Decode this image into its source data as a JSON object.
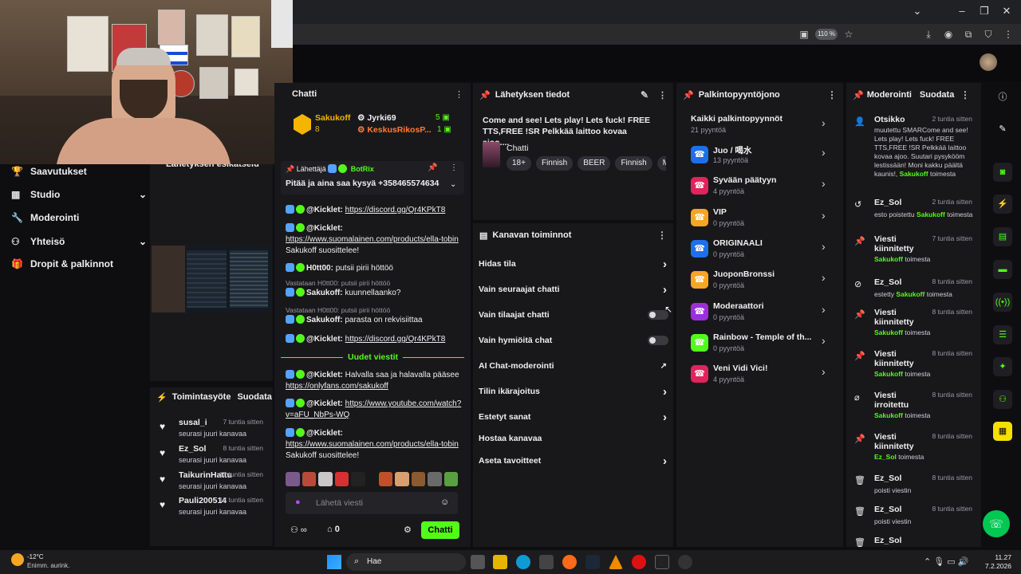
{
  "browser": {
    "zoom": "110 %"
  },
  "sidebar": {
    "items": [
      {
        "label": "Saavutukset",
        "icon": "trophy-icon",
        "chevron": false
      },
      {
        "label": "Studio",
        "icon": "studio-icon",
        "chevron": true
      },
      {
        "label": "Moderointi",
        "icon": "wrench-icon",
        "chevron": false
      },
      {
        "label": "Yhteisö",
        "icon": "community-icon",
        "chevron": true
      },
      {
        "label": "Dropit & palkinnot",
        "icon": "gift-icon",
        "chevron": false
      }
    ],
    "preview_title": "Lähetyksen esikatselu"
  },
  "activity": {
    "title": "Toimintasyöte",
    "subscribe": "Suodata",
    "items": [
      {
        "user": "susal_i",
        "time": "7 tuntia sitten",
        "text": "seurasi juuri kanavaa"
      },
      {
        "user": "Ez_Sol",
        "time": "8 tuntia sitten",
        "text": "seurasi juuri kanavaa"
      },
      {
        "user": "TaikurinHattu",
        "time": "12 tuntia sitten",
        "text": "seurasi juuri kanavaa"
      },
      {
        "user": "Pauli200514",
        "time": "12 tuntia sitten",
        "text": "seurasi juuri kanavaa"
      }
    ]
  },
  "chat": {
    "title": "Chatti",
    "leaderboard": [
      {
        "name": "Sakukoff",
        "count": "5",
        "sub": "8"
      },
      {
        "name": "Jyrki69",
        "count": "1",
        "sub": ""
      },
      {
        "name": "KeskusRikosP...",
        "count": "",
        "sub": ""
      }
    ],
    "pinned_sender_label": "Lähettäjä",
    "pinned_sender": "BotRix",
    "pinned_text": "Pitää ja aina saa kysyä +358465574634",
    "messages": [
      {
        "user": "@Kicklet:",
        "text": "https://discord.gg/Qr4KPkT8",
        "link": true
      },
      {
        "user": "@Kicklet:",
        "text": "https://www.suomalainen.com/products/ella-tobin",
        "link": true,
        "extra": "Sakukoff suosittelee!"
      },
      {
        "user": "H0tt00:",
        "text": "putsii pirii höttöö",
        "link": false
      },
      {
        "reply": "Vastataan H0tt00: putsii pirii höttöö",
        "user": "Sakukoff:",
        "text": "kuunnellaanko?"
      },
      {
        "reply": "Vastataan H0tt00: putsii pirii höttöö",
        "user": "Sakukoff:",
        "text": "parasta on rekvisiittaa"
      },
      {
        "user": "@Kicklet:",
        "text": "https://discord.gg/Qr4KPkT8",
        "link": true
      }
    ],
    "new_messages": "Uudet viestit",
    "messages2": [
      {
        "user": "@Kicklet:",
        "text": "Halvalla saa ja halavalla pääsee",
        "link2": "https://onlyfans.com/sakukoff"
      },
      {
        "user": "@Kicklet:",
        "text": "https://www.youtube.com/watch?v=aFU_NbPs-WQ"
      },
      {
        "user": "@Kicklet:",
        "text": "https://www.suomalainen.com/products/ella-tobin",
        "extra": "Sakukoff suosittelee!"
      }
    ],
    "input_placeholder": "Lähetä viesti",
    "points": "0",
    "send": "Chatti"
  },
  "stream_info": {
    "title": "Lähetyksen tiedot",
    "text": "Come and see! Lets play! Lets fuck! FREE TTS,FREE !SR Pelkkää laittoo kovaa ajoo....",
    "category": "Chatti",
    "tags": [
      "18+",
      "Finnish",
      "BEER",
      "Finnish",
      "M"
    ]
  },
  "channel_actions": {
    "title": "Kanavan toiminnot",
    "items": [
      {
        "label": "Hidas tila",
        "control": "chevron"
      },
      {
        "label": "Vain seuraajat chatti",
        "control": "chevron"
      },
      {
        "label": "Vain tilaajat chatti",
        "control": "toggle"
      },
      {
        "label": "Vain hymiöitä chat",
        "control": "toggle"
      },
      {
        "label": "AI Chat-moderointi",
        "control": "external"
      },
      {
        "label": "Tilin ikärajoitus",
        "control": "chevron"
      },
      {
        "label": "Estetyt sanat",
        "control": "chevron"
      },
      {
        "label": "Hostaa kanavaa",
        "control": "none"
      },
      {
        "label": "Aseta tavoitteet",
        "control": "chevron"
      }
    ]
  },
  "rewards": {
    "title": "Palkintopyyntöjono",
    "all_title": "Kaikki palkintopyynnöt",
    "all_count": "21 pyyntöä",
    "items": [
      {
        "name": "Juo / 喝水",
        "count": "13 pyyntöä",
        "color": "#1f6feb"
      },
      {
        "name": "Syvään päätyyn",
        "count": "4 pyyntöä",
        "color": "#e0245e"
      },
      {
        "name": "VIP",
        "count": "0 pyyntöä",
        "color": "#f5a623"
      },
      {
        "name": "ORIGINAALI",
        "count": "0 pyyntöä",
        "color": "#1f6feb"
      },
      {
        "name": "JuoponBronssi",
        "count": "0 pyyntöä",
        "color": "#f5a623"
      },
      {
        "name": "Moderaattori",
        "count": "0 pyyntöä",
        "color": "#9b30d9"
      },
      {
        "name": "Rainbow - Temple of th...",
        "count": "0 pyyntöä",
        "color": "#53fc18"
      },
      {
        "name": "Veni Vidi Vici!",
        "count": "4 pyyntöä",
        "color": "#e0245e"
      }
    ]
  },
  "moderation": {
    "title": "Moderointi",
    "filter": "Suodata",
    "items": [
      {
        "icon": "user-edit-icon",
        "name": "Otsikko",
        "time": "2 tuntia sitten",
        "desc": "muutettu SMARCome and see! Lets play! Lets fuck! FREE TTS,FREE !SR Pelkkää laittoo kovaa ajoo. Suutari pysykööm lestissään! Moni kakku päältä kaunis!,",
        "by": "Sakukoff",
        "action": "toimesta"
      },
      {
        "icon": "undo-icon",
        "name": "Ez_Sol",
        "time": "2 tuntia sitten",
        "desc": "esto poistettu",
        "by": "Sakukoff",
        "action": "toimesta"
      },
      {
        "icon": "pin-icon",
        "name": "Viesti kiinnitetty",
        "time": "7 tuntia sitten",
        "desc": "",
        "by": "Sakukoff",
        "action": "toimesta"
      },
      {
        "icon": "ban-icon",
        "name": "Ez_Sol",
        "time": "8 tuntia sitten",
        "desc": "estetty",
        "by": "Sakukoff",
        "action": "toimesta"
      },
      {
        "icon": "pin-icon",
        "name": "Viesti kiinnitetty",
        "time": "8 tuntia sitten",
        "desc": "",
        "by": "Sakukoff",
        "action": "toimesta"
      },
      {
        "icon": "pin-icon",
        "name": "Viesti kiinnitetty",
        "time": "8 tuntia sitten",
        "desc": "",
        "by": "Sakukoff",
        "action": "toimesta"
      },
      {
        "icon": "unpin-icon",
        "name": "Viesti irroitettu",
        "time": "8 tuntia sitten",
        "desc": "",
        "by": "Sakukoff",
        "action": "toimesta"
      },
      {
        "icon": "pin-icon",
        "name": "Viesti kiinnitetty",
        "time": "8 tuntia sitten",
        "desc": "",
        "by": "Ez_Sol",
        "action": "toimesta"
      },
      {
        "icon": "trash-icon",
        "name": "Ez_Sol",
        "time": "8 tuntia sitten",
        "desc": "poisti viestin",
        "by": "",
        "action": ""
      },
      {
        "icon": "trash-icon",
        "name": "Ez_Sol",
        "time": "8 tuntia sitten",
        "desc": "poisti viestin",
        "by": "",
        "action": ""
      },
      {
        "icon": "trash-icon",
        "name": "Ez_Sol",
        "time": "",
        "desc": "",
        "by": "",
        "action": ""
      }
    ]
  },
  "taskbar": {
    "weather_temp": "-12°C",
    "weather_desc": "Enimm. aurink.",
    "search": "Hae",
    "time": "11.27",
    "date": "7.2.2026"
  }
}
